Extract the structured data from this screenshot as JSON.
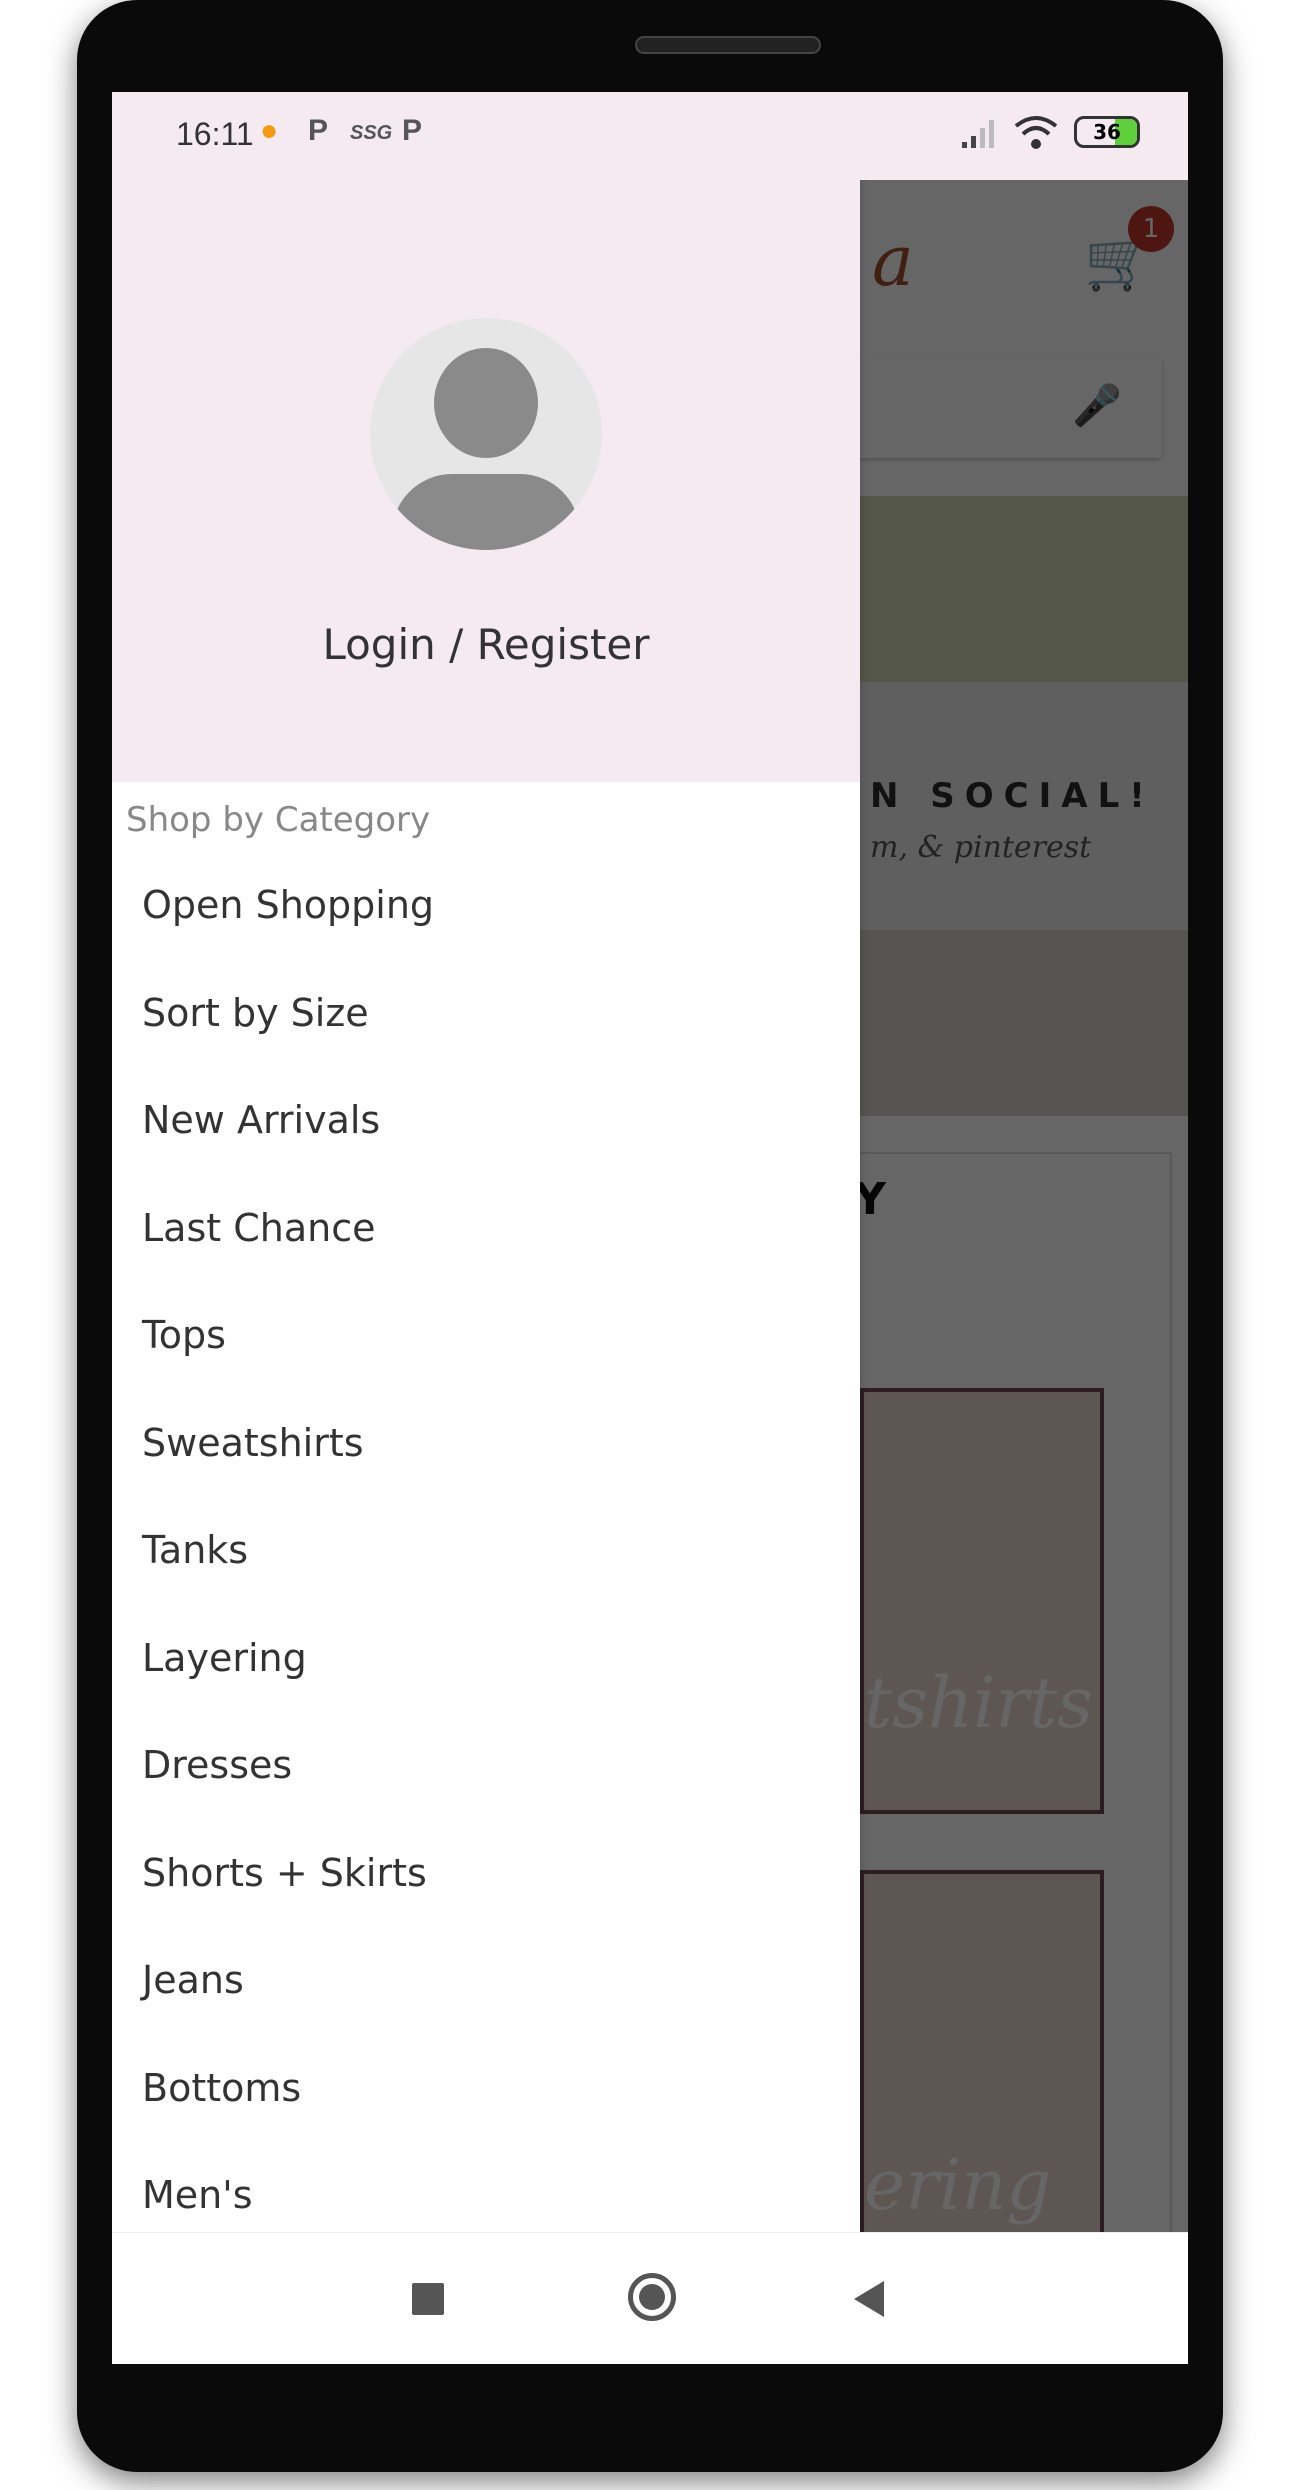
{
  "status_bar": {
    "time": "16:11",
    "icons": [
      "notification-drop-icon",
      "p-icon",
      "ssg-icon",
      "p-icon"
    ],
    "battery": "36"
  },
  "background_app": {
    "logo_fragment": "a",
    "cart_badge": "1",
    "banner_title": "N SOCIAL!",
    "banner_subtitle": "m, & pinterest",
    "section_fragment": "Y",
    "tile1_label": "tshirts",
    "tile2_label": "ering"
  },
  "drawer": {
    "login_label": "Login / Register",
    "section_title": "Shop by Category",
    "items": [
      "Open Shopping",
      "Sort by Size",
      "New Arrivals",
      "Last Chance",
      "Tops",
      "Sweatshirts",
      "Tanks",
      "Layering",
      "Dresses",
      "Shorts + Skirts",
      "Jeans",
      "Bottoms",
      "Men's"
    ]
  },
  "colors": {
    "header_bg": "#f5eaf0",
    "badge": "#c0392b",
    "battery_fill": "#5ccf3a"
  }
}
